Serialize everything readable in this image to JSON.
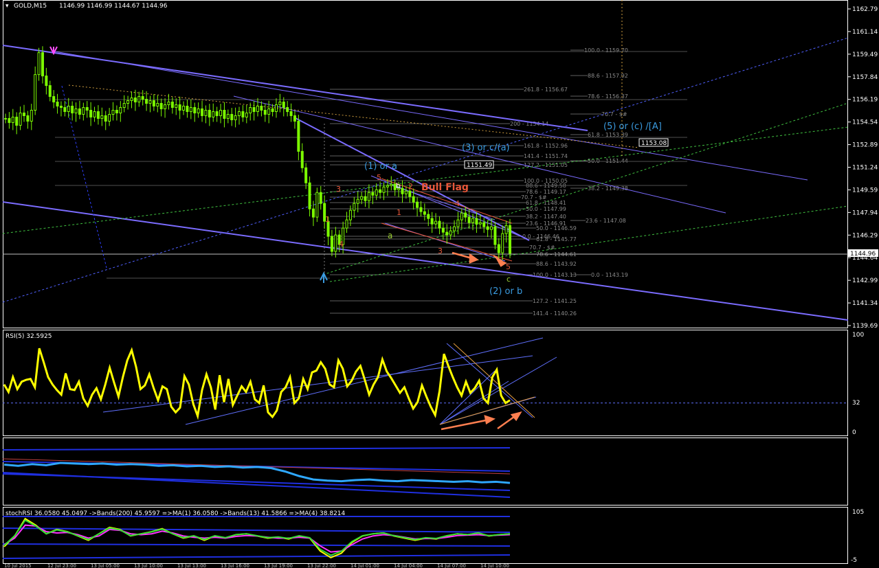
{
  "header": {
    "symbol": "GOLD,M15",
    "ohlc": "1146.99 1146.99 1144.67 1144.96"
  },
  "colors": {
    "background": "#000000",
    "bull_candle": "#7CFC00",
    "axis": "#FFFFFF",
    "trendline": "#7B6CFF",
    "fib": "#808080",
    "wave_label": "#3A9BE0",
    "count_label": "#E8573A",
    "rsi": "#FFFF00",
    "signal_arrow": "#FF7F50"
  },
  "chart_data": [
    {
      "type": "candlestick",
      "title": "GOLD,M15",
      "ylim": [
        1139.69,
        1162.79
      ],
      "y_ticks": [
        "1162.79",
        "1161.14",
        "1159.49",
        "1157.84",
        "1156.19",
        "1154.54",
        "1152.89",
        "1151.24",
        "1149.59",
        "1147.94",
        "1146.29",
        "1144.64",
        "1142.99",
        "1141.34",
        "1139.69"
      ],
      "last_price": "1144.96",
      "close": [
        1154.8,
        1154.5,
        1154.9,
        1154.3,
        1155.2,
        1155.0,
        1154.6,
        1155.4,
        1158.0,
        1159.6,
        1157.9,
        1157.2,
        1156.4,
        1156.0,
        1155.7,
        1155.6,
        1155.3,
        1155.7,
        1155.2,
        1155.5,
        1155.1,
        1155.6,
        1155.4,
        1154.9,
        1155.3,
        1154.8,
        1155.0,
        1154.6,
        1155.1,
        1155.4,
        1155.2,
        1155.6,
        1155.9,
        1156.1,
        1156.3,
        1156.0,
        1156.4,
        1156.2,
        1155.9,
        1156.1,
        1155.7,
        1155.9,
        1155.5,
        1155.8,
        1156.0,
        1155.6,
        1155.8,
        1155.4,
        1155.7,
        1155.3,
        1155.6,
        1155.2,
        1155.5,
        1155.0,
        1155.4,
        1154.9,
        1155.3,
        1155.0,
        1155.4,
        1154.8,
        1155.1,
        1154.7,
        1155.0,
        1155.3,
        1154.9,
        1155.2,
        1155.6,
        1155.3,
        1155.7,
        1155.4,
        1155.1,
        1155.5,
        1155.3,
        1155.8,
        1156.0,
        1155.6,
        1155.3,
        1155.0,
        1154.6,
        1152.4,
        1151.2,
        1150.1,
        1148.2,
        1147.6,
        1149.4,
        1148.6,
        1147.3,
        1146.2,
        1145.1,
        1146.3,
        1145.6,
        1146.8,
        1147.4,
        1148.1,
        1148.6,
        1148.9,
        1149.1,
        1148.8,
        1149.4,
        1149.2,
        1149.6,
        1149.4,
        1149.8,
        1149.9,
        1150.0,
        1149.6,
        1149.7,
        1149.3,
        1149.5,
        1149.1,
        1148.7,
        1148.3,
        1148.0,
        1147.8,
        1147.5,
        1147.1,
        1147.3,
        1146.8,
        1146.5,
        1146.3,
        1146.6,
        1146.9,
        1147.4,
        1147.9,
        1147.6,
        1147.2,
        1147.5,
        1147.1,
        1147.2,
        1146.9,
        1146.7,
        1146.9,
        1145.6,
        1145.0,
        1146.4,
        1146.99,
        1144.96
      ],
      "fib_levels": [
        {
          "label": "100.0 - 1159.70"
        },
        {
          "label": "88.6 - 1157.92"
        },
        {
          "label": "261.8 - 1156.67"
        },
        {
          "label": "78.6 - 1156.37"
        },
        {
          "label": "70.7 - $#"
        },
        {
          "label": "200 - 1154.14"
        },
        {
          "label": "61.8 - 1153.39"
        },
        {
          "label": "161.8 - 1152.96"
        },
        {
          "label": "141.4 - 1151.74"
        },
        {
          "label": "50.0 - 1151.44"
        },
        {
          "label": "127.2 - 1151.05"
        },
        {
          "label": "100.0 - 1150.05"
        },
        {
          "label": "88.6 - 1149.58"
        },
        {
          "label": "38.2 - 1149.38"
        },
        {
          "label": "78.6 - 1149.17"
        },
        {
          "label": "70.7 - $#"
        },
        {
          "label": "61.8 - 1148.41"
        },
        {
          "label": "50.0 - 1147.99"
        },
        {
          "label": "38.2 - 1147.40"
        },
        {
          "label": "23.6 - 1147.08"
        },
        {
          "label": "23.6 - 1146.91"
        },
        {
          "label": "50.0 - 1146.59"
        },
        {
          "label": "0.0 - 1146.46"
        },
        {
          "label": "61.8 - 1145.77"
        },
        {
          "label": "70.7 - $#"
        },
        {
          "label": "78.6 - 1144.61"
        },
        {
          "label": "88.6 - 1143.92"
        },
        {
          "label": "100.0 - 1143.13"
        },
        {
          "label": "0.0 - 1143.19"
        },
        {
          "label": "127.2 - 1141.25"
        },
        {
          "label": "141.4 - 1140.26"
        }
      ],
      "price_boxes": [
        "1153.08",
        "1151.49"
      ],
      "wave_labels": [
        "(1) or a",
        "(3) or c/(a)",
        "(5) or (c) /[A]",
        "(2) or b",
        "Bull Flag"
      ],
      "count_labels": [
        "5",
        "3",
        "1",
        "4",
        "b",
        "2",
        "1",
        "3",
        "4",
        "5",
        "a",
        "c"
      ]
    },
    {
      "type": "line",
      "title": "RSI(5) 32.5925",
      "ylim": [
        0,
        100
      ],
      "y_ticks": [
        "100",
        "32",
        "0"
      ],
      "level": 32,
      "values": [
        52,
        44,
        60,
        47,
        55,
        57,
        58,
        49,
        91,
        76,
        60,
        52,
        46,
        41,
        64,
        47,
        46,
        55,
        37,
        29,
        41,
        48,
        36,
        52,
        70,
        54,
        39,
        60,
        78,
        89,
        71,
        47,
        51,
        63,
        48,
        35,
        50,
        47,
        28,
        22,
        27,
        61,
        52,
        31,
        18,
        46,
        63,
        49,
        25,
        62,
        33,
        58,
        30,
        40,
        50,
        44,
        55,
        36,
        32,
        51,
        22,
        17,
        24,
        44,
        49,
        60,
        32,
        37,
        58,
        47,
        65,
        67,
        76,
        69,
        52,
        49,
        78,
        69,
        50,
        56,
        66,
        72,
        57,
        41,
        52,
        60,
        79,
        66,
        59,
        51,
        43,
        49,
        37,
        26,
        33,
        51,
        39,
        28,
        19,
        45,
        85,
        72,
        60,
        49,
        40,
        55,
        43,
        48,
        56,
        37,
        32,
        60,
        68,
        40,
        32,
        35
      ]
    },
    {
      "type": "line",
      "title": "",
      "series": [
        {
          "values": [
            62,
            60,
            63,
            61,
            65,
            64,
            63,
            64,
            62,
            63,
            62,
            60,
            61,
            59,
            60,
            58,
            59,
            57,
            58,
            56,
            50,
            42,
            36,
            34,
            33,
            35,
            36,
            34,
            33,
            35,
            34,
            33,
            32,
            33,
            31,
            32,
            30
          ]
        }
      ]
    },
    {
      "type": "line",
      "title": "stochRSI 36.0580 45.0497   ->Bands(200) 45.9597   =>MA(1) 36.0580   ->Bands(13) 41.5866   =>MA(4) 38.8214",
      "y_ticks": [
        "105",
        "-5"
      ],
      "series": [
        {
          "values": [
            30,
            55,
            95,
            80,
            60,
            70,
            65,
            55,
            45,
            60,
            75,
            70,
            55,
            60,
            65,
            72,
            60,
            50,
            55,
            45,
            55,
            50,
            58,
            60,
            55,
            50,
            52,
            48,
            55,
            50,
            20,
            5,
            15,
            40,
            55,
            60,
            62,
            55,
            50,
            45,
            50,
            48,
            55,
            60,
            58,
            62,
            55,
            58,
            60
          ]
        },
        {
          "values": [
            35,
            50,
            80,
            78,
            65,
            62,
            63,
            58,
            50,
            55,
            70,
            68,
            60,
            58,
            60,
            66,
            62,
            55,
            52,
            50,
            52,
            50,
            54,
            56,
            55,
            52,
            50,
            50,
            52,
            50,
            32,
            18,
            20,
            35,
            48,
            55,
            58,
            56,
            52,
            48,
            49,
            49,
            52,
            56,
            57,
            58,
            56,
            57,
            58
          ]
        }
      ]
    }
  ],
  "time_axis": [
    "10 Jul 2015",
    "12 Jul 23:00",
    "13 Jul 05:00",
    "13 Jul 10:00",
    "13 Jul 13:00",
    "13 Jul 16:00",
    "13 Jul 19:00",
    "13 Jul 22:00",
    "14 Jul 01:00",
    "14 Jul 04:00",
    "14 Jul 07:00",
    "14 Jul 10:00"
  ]
}
